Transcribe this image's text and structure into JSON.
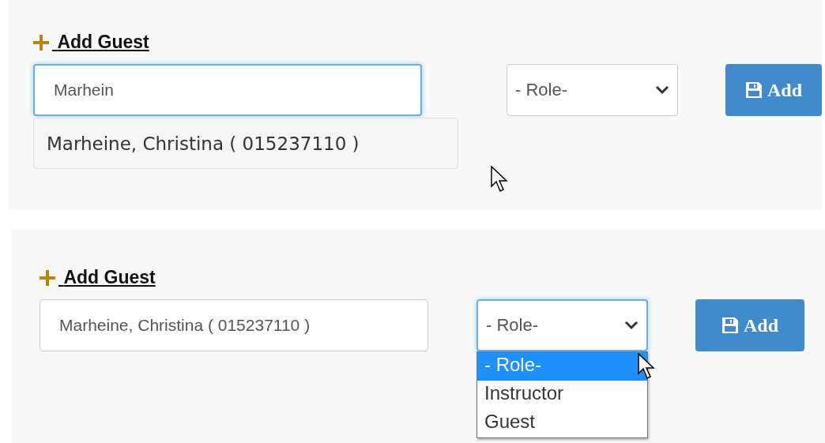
{
  "panels": [
    {
      "heading": "Add Guest",
      "name_field": {
        "value": "Marhein",
        "focused": true
      },
      "suggestions": [
        "Marheine, Christina ( 015237110 )"
      ],
      "role_select": {
        "value": "- Role-",
        "focused": false,
        "expanded": false
      },
      "button": "Add",
      "cursor": true
    },
    {
      "heading": "Add Guest",
      "name_field": {
        "value": "Marheine, Christina ( 015237110 )",
        "focused": false
      },
      "role_select": {
        "value": "- Role-",
        "focused": true,
        "expanded": true,
        "options": [
          {
            "label": "- Role-",
            "selected": true
          },
          {
            "label": "Instructor",
            "selected": false
          },
          {
            "label": "Guest",
            "selected": false
          }
        ]
      },
      "button": "Add",
      "cursor": true
    }
  ]
}
